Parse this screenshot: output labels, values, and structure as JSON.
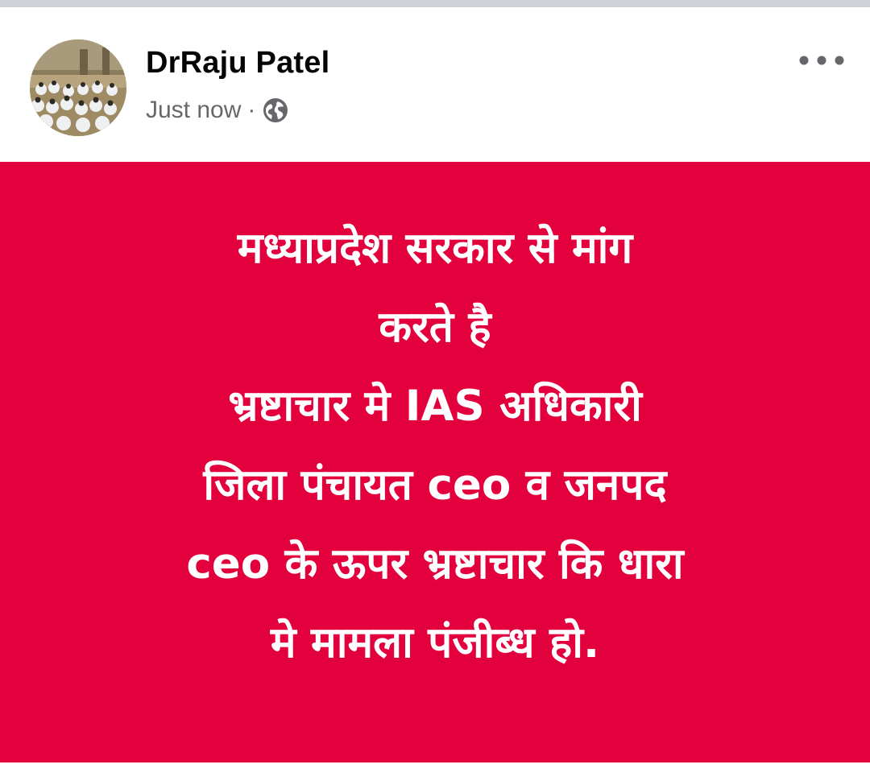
{
  "post": {
    "author_name": "DrRaju Patel",
    "timestamp": "Just now",
    "separator": "·",
    "audience_icon": "globe-icon",
    "more_icon": "more-options-icon",
    "avatar_description_icon": "profile-photo-avatar",
    "card_color": "#e2003d",
    "text_color": "#ffffff",
    "text_lines": [
      "मध्याप्रदेश सरकार से मांग",
      "करते है",
      "भ्रष्टाचार मे IAS अधिकारी",
      "जिला पंचायत ceo व जनपद",
      "ceo के ऊपर भ्रष्टाचार कि धारा",
      "मे मामला पंजीब्ध हो."
    ]
  }
}
